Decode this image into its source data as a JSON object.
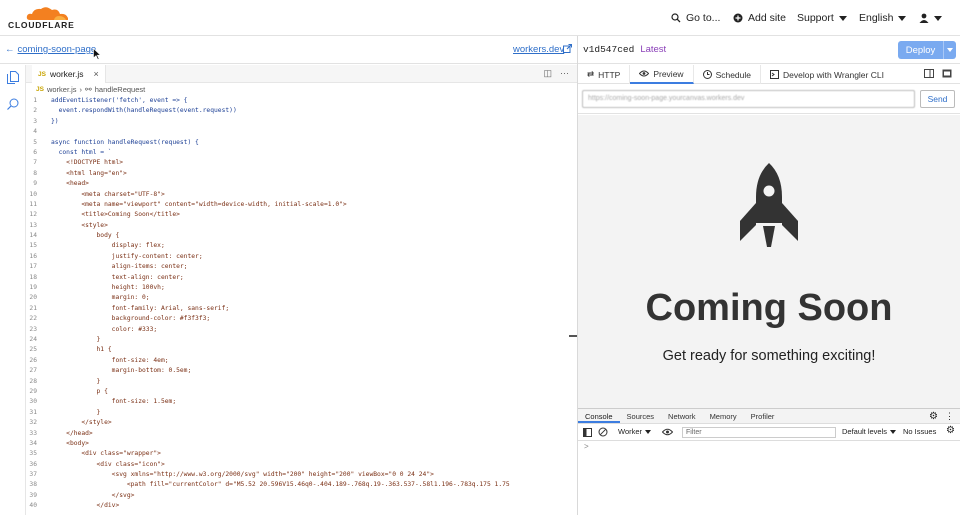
{
  "brand": {
    "wordmark": "CLOUDFLARE",
    "accent": "#f38020"
  },
  "topnav": {
    "goto": "Go to...",
    "add_site": "Add site",
    "support": "Support",
    "language": "English"
  },
  "subbar": {
    "back_label": "coming-soon-page",
    "workers_link": "workers.dev",
    "version_prefix": "v",
    "version_id": "1d547ced",
    "version_tag": "Latest",
    "deploy": "Deploy"
  },
  "editor": {
    "file_tab": "worker.js",
    "file_badge": "JS",
    "breadcrumb": [
      "worker.js",
      "handleRequest"
    ],
    "lines": [
      {
        "n": "1",
        "code": "addEventListener('fetch', event => {",
        "kind": "blue"
      },
      {
        "n": "2",
        "code": "  event.respondWith(handleRequest(event.request))",
        "kind": "blue"
      },
      {
        "n": "3",
        "code": "})",
        "kind": "blue"
      },
      {
        "n": "4",
        "code": "",
        "kind": "blue"
      },
      {
        "n": "5",
        "code": "async function handleRequest(request) {",
        "kind": "blue"
      },
      {
        "n": "6",
        "code": "  const html = `",
        "kind": "blue"
      },
      {
        "n": "7",
        "code": "    <!DOCTYPE html>",
        "kind": "str"
      },
      {
        "n": "8",
        "code": "    <html lang=\"en\">",
        "kind": "str"
      },
      {
        "n": "9",
        "code": "    <head>",
        "kind": "str"
      },
      {
        "n": "10",
        "code": "        <meta charset=\"UTF-8\">",
        "kind": "str"
      },
      {
        "n": "11",
        "code": "        <meta name=\"viewport\" content=\"width=device-width, initial-scale=1.0\">",
        "kind": "str"
      },
      {
        "n": "12",
        "code": "        <title>Coming Soon</title>",
        "kind": "str"
      },
      {
        "n": "13",
        "code": "        <style>",
        "kind": "str"
      },
      {
        "n": "14",
        "code": "            body {",
        "kind": "str"
      },
      {
        "n": "15",
        "code": "                display: flex;",
        "kind": "str"
      },
      {
        "n": "16",
        "code": "                justify-content: center;",
        "kind": "str"
      },
      {
        "n": "17",
        "code": "                align-items: center;",
        "kind": "str"
      },
      {
        "n": "18",
        "code": "                text-align: center;",
        "kind": "str"
      },
      {
        "n": "19",
        "code": "                height: 100vh;",
        "kind": "str"
      },
      {
        "n": "20",
        "code": "                margin: 0;",
        "kind": "str"
      },
      {
        "n": "21",
        "code": "                font-family: Arial, sans-serif;",
        "kind": "str"
      },
      {
        "n": "22",
        "code": "                background-color: #f3f3f3;",
        "kind": "str"
      },
      {
        "n": "23",
        "code": "                color: #333;",
        "kind": "str"
      },
      {
        "n": "24",
        "code": "            }",
        "kind": "str"
      },
      {
        "n": "25",
        "code": "            h1 {",
        "kind": "str"
      },
      {
        "n": "26",
        "code": "                font-size: 4em;",
        "kind": "str"
      },
      {
        "n": "27",
        "code": "                margin-bottom: 0.5em;",
        "kind": "str"
      },
      {
        "n": "28",
        "code": "            }",
        "kind": "str"
      },
      {
        "n": "29",
        "code": "            p {",
        "kind": "str"
      },
      {
        "n": "30",
        "code": "                font-size: 1.5em;",
        "kind": "str"
      },
      {
        "n": "31",
        "code": "            }",
        "kind": "str"
      },
      {
        "n": "32",
        "code": "        </style>",
        "kind": "str"
      },
      {
        "n": "33",
        "code": "    </head>",
        "kind": "str"
      },
      {
        "n": "34",
        "code": "    <body>",
        "kind": "str"
      },
      {
        "n": "35",
        "code": "        <div class=\"wrapper\">",
        "kind": "str"
      },
      {
        "n": "36",
        "code": "            <div class=\"icon\">",
        "kind": "str"
      },
      {
        "n": "37",
        "code": "                <svg xmlns=\"http://www.w3.org/2000/svg\" width=\"200\" height=\"200\" viewBox=\"0 0 24 24\">",
        "kind": "str"
      },
      {
        "n": "38",
        "code": "                    <path fill=\"currentColor\" d=\"M5.52 20.596V15.46q0-.404.189-.768q.19-.363.537-.58l1.196-.783q.175 1.75",
        "kind": "str"
      },
      {
        "n": "39",
        "code": "                </svg>",
        "kind": "str"
      },
      {
        "n": "40",
        "code": "            </div>",
        "kind": "str"
      }
    ]
  },
  "preview": {
    "tabs": [
      "HTTP",
      "Preview",
      "Schedule",
      "Develop with Wrangler CLI"
    ],
    "active_tab": "Preview",
    "url_value": "https://coming-soon-page.yourcanvas.workers.dev",
    "send": "Send",
    "page_title": "Coming Soon",
    "page_subtitle": "Get ready for something exciting!"
  },
  "devtools": {
    "tabs": [
      "Console",
      "Sources",
      "Network",
      "Memory",
      "Profiler"
    ],
    "active_tab": "Console",
    "context": "Worker",
    "filter_placeholder": "Filter",
    "levels": "Default levels",
    "issues": "No Issues",
    "prompt": ">"
  }
}
